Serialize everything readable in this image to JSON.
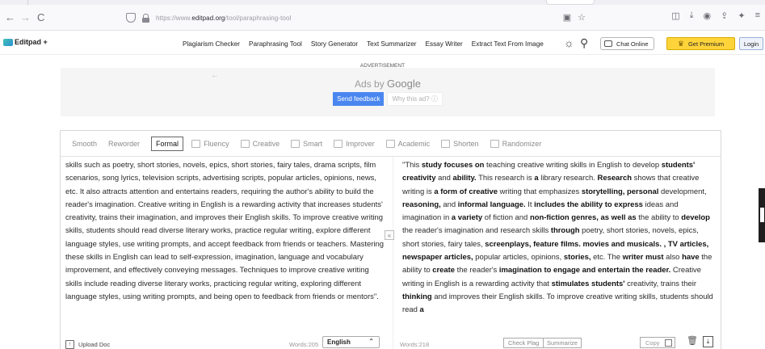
{
  "browser": {
    "back": "←",
    "forward": "→",
    "reload": "C",
    "url_prefix": "https://www.",
    "url_host": "editpad.org",
    "url_path": "/tool/paraphrasing-tool"
  },
  "header": {
    "logo": "Editpad +",
    "nav": [
      "Plagiarism Checker",
      "Paraphrasing Tool",
      "Story Generator",
      "Text Summarizer",
      "Essay Writer",
      "Extract Text From Image"
    ],
    "chat_online": "Chat Online",
    "get_premium": "Get Premium",
    "login": "Login"
  },
  "ad": {
    "label": "ADVERTISEMENT",
    "ads_by": "Ads by",
    "google": "Google",
    "send_feedback": "Send feedback",
    "why_this_ad": "Why this ad? ⓘ"
  },
  "modes": [
    {
      "label": "Smooth",
      "active": false
    },
    {
      "label": "Reworder",
      "active": false
    },
    {
      "label": "Formal",
      "active": true
    },
    {
      "label": "Fluency",
      "active": false
    },
    {
      "label": "Creative",
      "active": false
    },
    {
      "label": "Smart",
      "active": false
    },
    {
      "label": "Improver",
      "active": false
    },
    {
      "label": "Academic",
      "active": false
    },
    {
      "label": "Shorten",
      "active": false
    },
    {
      "label": "Randomizer",
      "active": false
    }
  ],
  "input_text": "skills such as poetry, short stories, novels, epics, short stories, fairy tales, drama scripts, film scenarios, song lyrics, television scripts, advertising scripts, popular articles, opinions, news, etc. It also attracts attention and entertains readers, requiring the author's ability to build the reader's imagination. Creative writing in English is a rewarding activity that increases students' creativity, trains their imagination, and improves their English skills. To improve creative writing skills, students should read diverse literary works, practice regular writing, explore different language styles, use writing prompts, and accept feedback from friends or teachers. Mastering these skills in English can lead to self-expression, imagination, language and vocabulary improvement, and effectively conveying messages. Techniques to improve creative writing skills include reading diverse literary works, practicing regular writing, exploring different language styles, using writing prompts, and being open to feedback from friends or mentors\".",
  "output_segments": [
    {
      "t": "\"This ",
      "b": false
    },
    {
      "t": "study focuses on",
      "b": true
    },
    {
      "t": " teaching creative writing skills in English to develop ",
      "b": false
    },
    {
      "t": "students' creativity",
      "b": true
    },
    {
      "t": " and ",
      "b": false
    },
    {
      "t": "ability.",
      "b": true
    },
    {
      "t": " This research is ",
      "b": false
    },
    {
      "t": "a",
      "b": true
    },
    {
      "t": " library research. ",
      "b": false
    },
    {
      "t": "Research",
      "b": true
    },
    {
      "t": " shows that creative writing is ",
      "b": false
    },
    {
      "t": "a form of creative",
      "b": true
    },
    {
      "t": " writing that emphasizes ",
      "b": false
    },
    {
      "t": "storytelling, personal",
      "b": true
    },
    {
      "t": " development, ",
      "b": false
    },
    {
      "t": "reasoning,",
      "b": true
    },
    {
      "t": " and ",
      "b": false
    },
    {
      "t": "informal language.",
      "b": true
    },
    {
      "t": " It ",
      "b": false
    },
    {
      "t": "includes the ability to express",
      "b": true
    },
    {
      "t": " ideas and imagination in ",
      "b": false
    },
    {
      "t": "a variety",
      "b": true
    },
    {
      "t": " of fiction and ",
      "b": false
    },
    {
      "t": "non-fiction genres, as well as",
      "b": true
    },
    {
      "t": " the ability to ",
      "b": false
    },
    {
      "t": "develop",
      "b": true
    },
    {
      "t": " the reader's imagination and research skills ",
      "b": false
    },
    {
      "t": "through",
      "b": true
    },
    {
      "t": " poetry, short stories, novels, epics, short stories, fairy tales, ",
      "b": false
    },
    {
      "t": "screenplays, feature films. movies and musicals. ,",
      "b": true
    },
    {
      "t": " ",
      "b": false
    },
    {
      "t": "TV articles, newspaper articles,",
      "b": true
    },
    {
      "t": " popular articles, opinions, ",
      "b": false
    },
    {
      "t": "stories,",
      "b": true
    },
    {
      "t": " etc. The ",
      "b": false
    },
    {
      "t": "writer must",
      "b": true
    },
    {
      "t": " also ",
      "b": false
    },
    {
      "t": "have",
      "b": true
    },
    {
      "t": " the ability to ",
      "b": false
    },
    {
      "t": "create",
      "b": true
    },
    {
      "t": " the reader's ",
      "b": false
    },
    {
      "t": "imagination to engage and entertain the reader.",
      "b": true
    },
    {
      "t": " Creative writing in English is a rewarding activity that ",
      "b": false
    },
    {
      "t": "stimulates students'",
      "b": true
    },
    {
      "t": " creativity, trains their ",
      "b": false
    },
    {
      "t": "thinking",
      "b": true
    },
    {
      "t": " and improves their English skills. To improve creative writing skills, students should read ",
      "b": false
    },
    {
      "t": "a",
      "b": true
    }
  ],
  "footer": {
    "upload_doc": "Upload Doc",
    "words_input": "Words:205",
    "language": "English",
    "words_output": "Words:218",
    "check_plag": "Check Plag",
    "summarize": "Summarize",
    "copy": "Copy"
  }
}
